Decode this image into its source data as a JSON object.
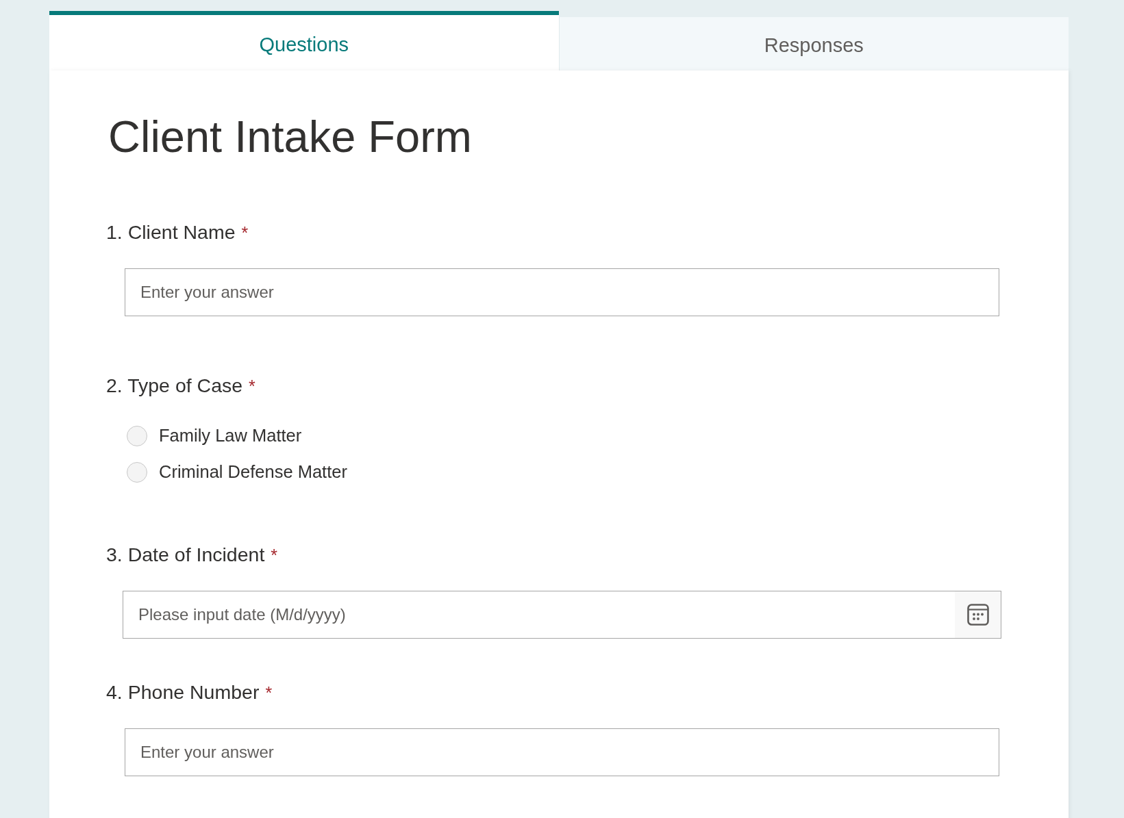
{
  "tabs": [
    {
      "label": "Questions",
      "selected": true
    },
    {
      "label": "Responses",
      "selected": false
    }
  ],
  "form": {
    "title": "Client Intake Form",
    "questions": [
      {
        "kind": "text",
        "label": "1. Client Name",
        "required_mark": "*",
        "placeholder": "Enter your answer"
      },
      {
        "kind": "choice",
        "label": "2. Type of Case",
        "required_mark": "*",
        "options": [
          {
            "label": "Family Law Matter",
            "selected": false
          },
          {
            "label": "Criminal Defense Matter",
            "selected": false
          }
        ]
      },
      {
        "kind": "date",
        "label": "3. Date of Incident",
        "required_mark": "*",
        "placeholder": "Please input date (M/d/yyyy)"
      },
      {
        "kind": "text",
        "label": "4. Phone Number",
        "required_mark": "*",
        "placeholder": "Enter your answer"
      }
    ]
  }
}
